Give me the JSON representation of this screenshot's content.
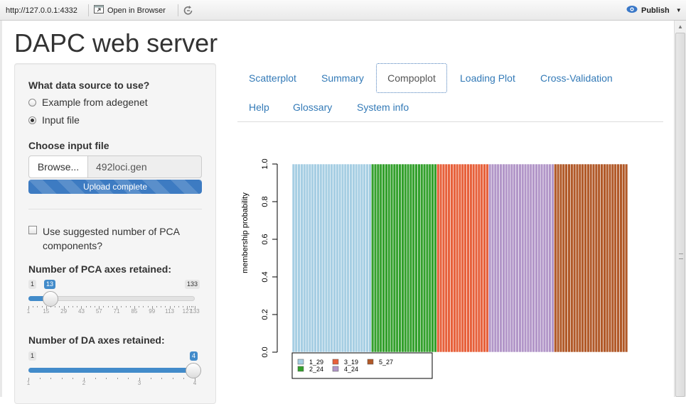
{
  "toolbar": {
    "url": "http://127.0.0.1:4332",
    "open_in_browser": "Open in Browser",
    "publish": "Publish"
  },
  "page_title": "DAPC web server",
  "sidebar": {
    "data_source_label": "What data source to use?",
    "options": [
      "Example from adegenet",
      "Input file"
    ],
    "selected_option": "Input file",
    "file_label": "Choose input file",
    "browse_label": "Browse...",
    "file_name": "492loci.gen",
    "upload_status": "Upload complete",
    "pca_checkbox_label_1": "Use suggested number of PCA",
    "pca_checkbox_label_2": "components?",
    "pca_checkbox_checked": false,
    "pca_slider": {
      "label": "Number of PCA axes retained:",
      "min": 1,
      "max": 133,
      "value": 13,
      "min_label": "1",
      "max_label": "133",
      "value_label": "13",
      "tick_labels": [
        "1",
        "15",
        "29",
        "43",
        "57",
        "71",
        "85",
        "99",
        "113",
        "127",
        "133"
      ]
    },
    "da_slider": {
      "label": "Number of DA axes retained:",
      "min": 1,
      "max": 4,
      "value": 4,
      "min_label": "1",
      "value_label": "4",
      "tick_labels": [
        "1",
        "2",
        "3",
        "4"
      ]
    }
  },
  "tabs": [
    "Scatterplot",
    "Summary",
    "Compoplot",
    "Loading Plot",
    "Cross-Validation",
    "Help",
    "Glossary",
    "System info"
  ],
  "active_tab": "Compoplot",
  "chart_data": {
    "type": "bar",
    "stacked": true,
    "ylabel": "membership probability",
    "ylim": [
      0,
      1
    ],
    "yticks": [
      "0.0",
      "0.2",
      "0.4",
      "0.6",
      "0.8",
      "1.0"
    ],
    "legend": {
      "placement": "bottom-left"
    },
    "groups": [
      {
        "name": "1_29",
        "color": "#a6cee3",
        "count": 29,
        "membership": 1.0
      },
      {
        "name": "2_24",
        "color": "#33a02c",
        "count": 24,
        "membership": 1.0
      },
      {
        "name": "3_19",
        "color": "#e7603a",
        "count": 19,
        "membership": 1.0
      },
      {
        "name": "4_24",
        "color": "#b296c8",
        "count": 24,
        "membership": 1.0
      },
      {
        "name": "5_27",
        "color": "#b15928",
        "count": 27,
        "membership": 1.0
      }
    ],
    "legend_order": [
      "1_29",
      "2_24",
      "3_19",
      "4_24",
      "5_27"
    ]
  },
  "icons": {
    "open_browser": "open-in-browser-icon",
    "refresh": "refresh-icon",
    "publish": "publish-icon"
  }
}
